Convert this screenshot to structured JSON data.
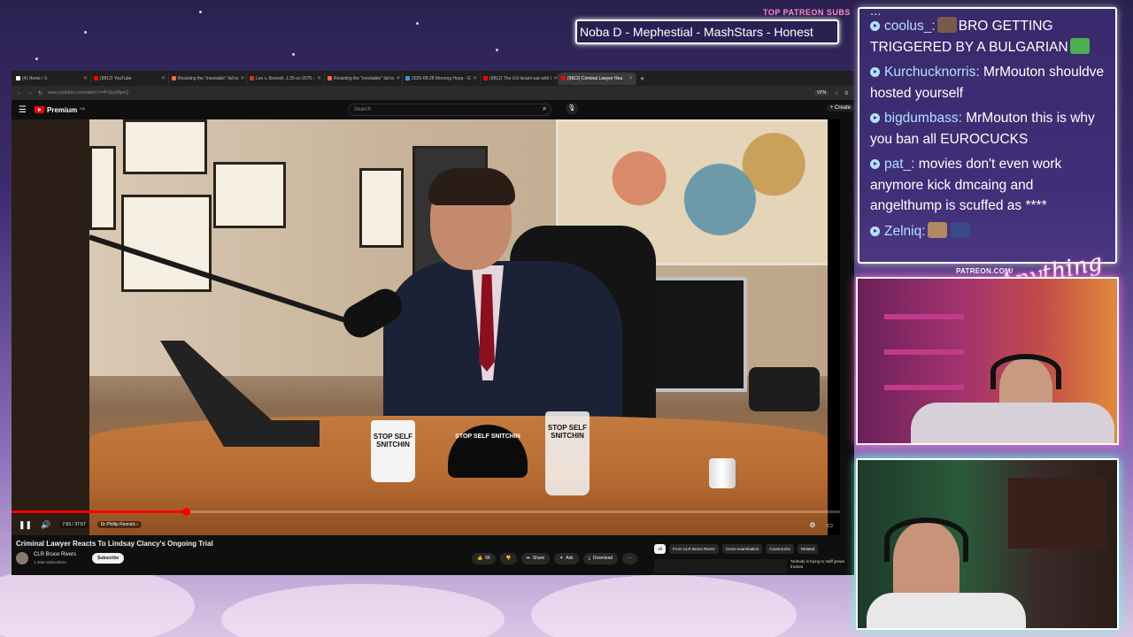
{
  "overlay": {
    "top_patreon_label": "TOP PATREON SUBS",
    "ticker_text": "Noba D - Mephestial - MashStars - Honest",
    "patreon_url": "PATREON.COM/",
    "signature": "Anything Else?"
  },
  "browser": {
    "tabs": [
      {
        "label": "(4) Home / X",
        "color": "#ffffff"
      },
      {
        "label": "(9812) YouTube",
        "color": "#ff0000"
      },
      {
        "label": "Resisting the \"inevitable\" fall to",
        "color": "#ff6a3d"
      },
      {
        "label": "Leo v. Bonnell, 1:25-cv-2075 -",
        "color": "#c0392b"
      },
      {
        "label": "Resisting the \"inevitable\" fall to",
        "color": "#ff6a3d"
      },
      {
        "label": "2025-08-28 Morning Hoop - G",
        "color": "#4a90e2"
      },
      {
        "label": "(9812) The US-Israeli war with I",
        "color": "#ff0000"
      },
      {
        "label": "(9812) Criminal Lawyer Rea",
        "color": "#ff0000"
      }
    ],
    "new_tab": "+",
    "url": "www.youtube.com/watch?v=ff-OjvyMpeQ",
    "vpn_label": "VPN"
  },
  "youtube": {
    "logo_text": "Premium",
    "logo_sup": "CA",
    "search_placeholder": "Search",
    "create_label": "+ Create",
    "time": "7:53 / 37:57",
    "chapter": "Dr Phillip Resnick ›",
    "progress_fraction": 0.21,
    "buffer_fraction": 0.27,
    "video_title": "Criminal Lawyer Reacts To Lindsay Clancy's Ongoing Trial",
    "channel_name": "CLR Bruce Rivers",
    "channel_subs": "1.45M subscribers",
    "subscribe_label": "Subscribe",
    "actions": [
      {
        "icon": "👍",
        "label": "6K"
      },
      {
        "icon": "👎",
        "label": ""
      },
      {
        "icon": "➦",
        "label": "Share"
      },
      {
        "icon": "✦",
        "label": "Ask"
      },
      {
        "icon": "⤓",
        "label": "Download"
      },
      {
        "icon": "",
        "label": "⋯"
      }
    ],
    "chips": [
      "All",
      "From CLR Bruce Rivers",
      "Cross-examination",
      "Courtrooms",
      "Related"
    ],
    "related_snippet": "'Nobody is trying to staff grows frustrat",
    "mug_text_1": "STOP SELF SNITCHIN",
    "cap_text": "STOP SELF SNITCHIN",
    "mug_text_2": "STOP SELF SNITCHIN"
  },
  "chat": {
    "truncated_top": "...",
    "messages": [
      {
        "user": "coolus_:",
        "text": "BRO GETTING TRIGGERED BY A BULGARIAN",
        "emote_before": "#7a5a4a",
        "emote_after": "#4caf50"
      },
      {
        "user": "Kurchucknorris:",
        "text": "MrMouton shouldve hosted yourself"
      },
      {
        "user": "bigdumbass:",
        "text": "MrMouton this is why you ban all EUROCUCKS"
      },
      {
        "user": "pat_:",
        "text": "movies don't even work anymore kick dmcaing and angelthump is scuffed as ****"
      },
      {
        "user": "Zelniq:",
        "text": "",
        "emote_before": "#b08a60",
        "emote_after": "#3a4a8a"
      }
    ]
  }
}
